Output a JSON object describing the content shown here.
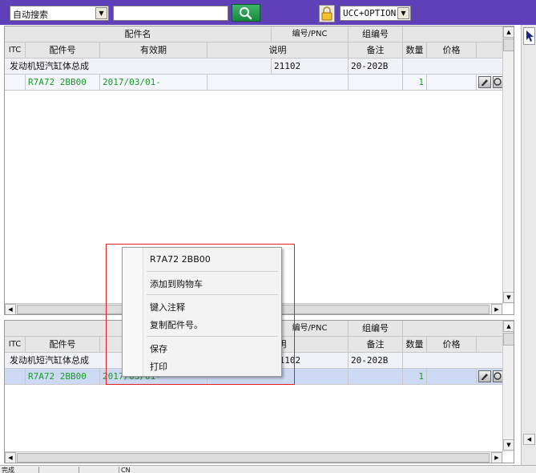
{
  "toolbar": {
    "search_mode": "自动搜索",
    "search_input": "",
    "filter": "UCC+OPTION"
  },
  "columns": {
    "part_name": "配件名",
    "pnc": "编号/PNC",
    "group_no": "组编号",
    "itc": "ITC",
    "part_no": "配件号",
    "validity": "有效期",
    "description": "说明",
    "remark": "备注",
    "qty": "数量",
    "price": "价格"
  },
  "top_grid": {
    "main_row": {
      "name": "发动机短汽缸体总成",
      "pnc": "21102",
      "group": "20-202B"
    },
    "sub_row": {
      "part_no": "R7A72 2BB00",
      "validity": "2017/03/01-",
      "qty": "1"
    }
  },
  "bottom_grid": {
    "main_row": {
      "name": "发动机短汽缸体总成",
      "pnc": "21102",
      "group": "20-202B"
    },
    "sub_row": {
      "part_no": "R7A72 2BB00",
      "validity": "2017/03/01-",
      "qty": "1"
    }
  },
  "context_menu": {
    "header": "R7A72 2BB00",
    "add_to_cart": "添加到购物车",
    "add_note": "键入注释",
    "copy_part_no": "复制配件号。",
    "save": "保存",
    "print": "打印"
  },
  "status": {
    "seg1": "完成",
    "seg4": "CN"
  }
}
